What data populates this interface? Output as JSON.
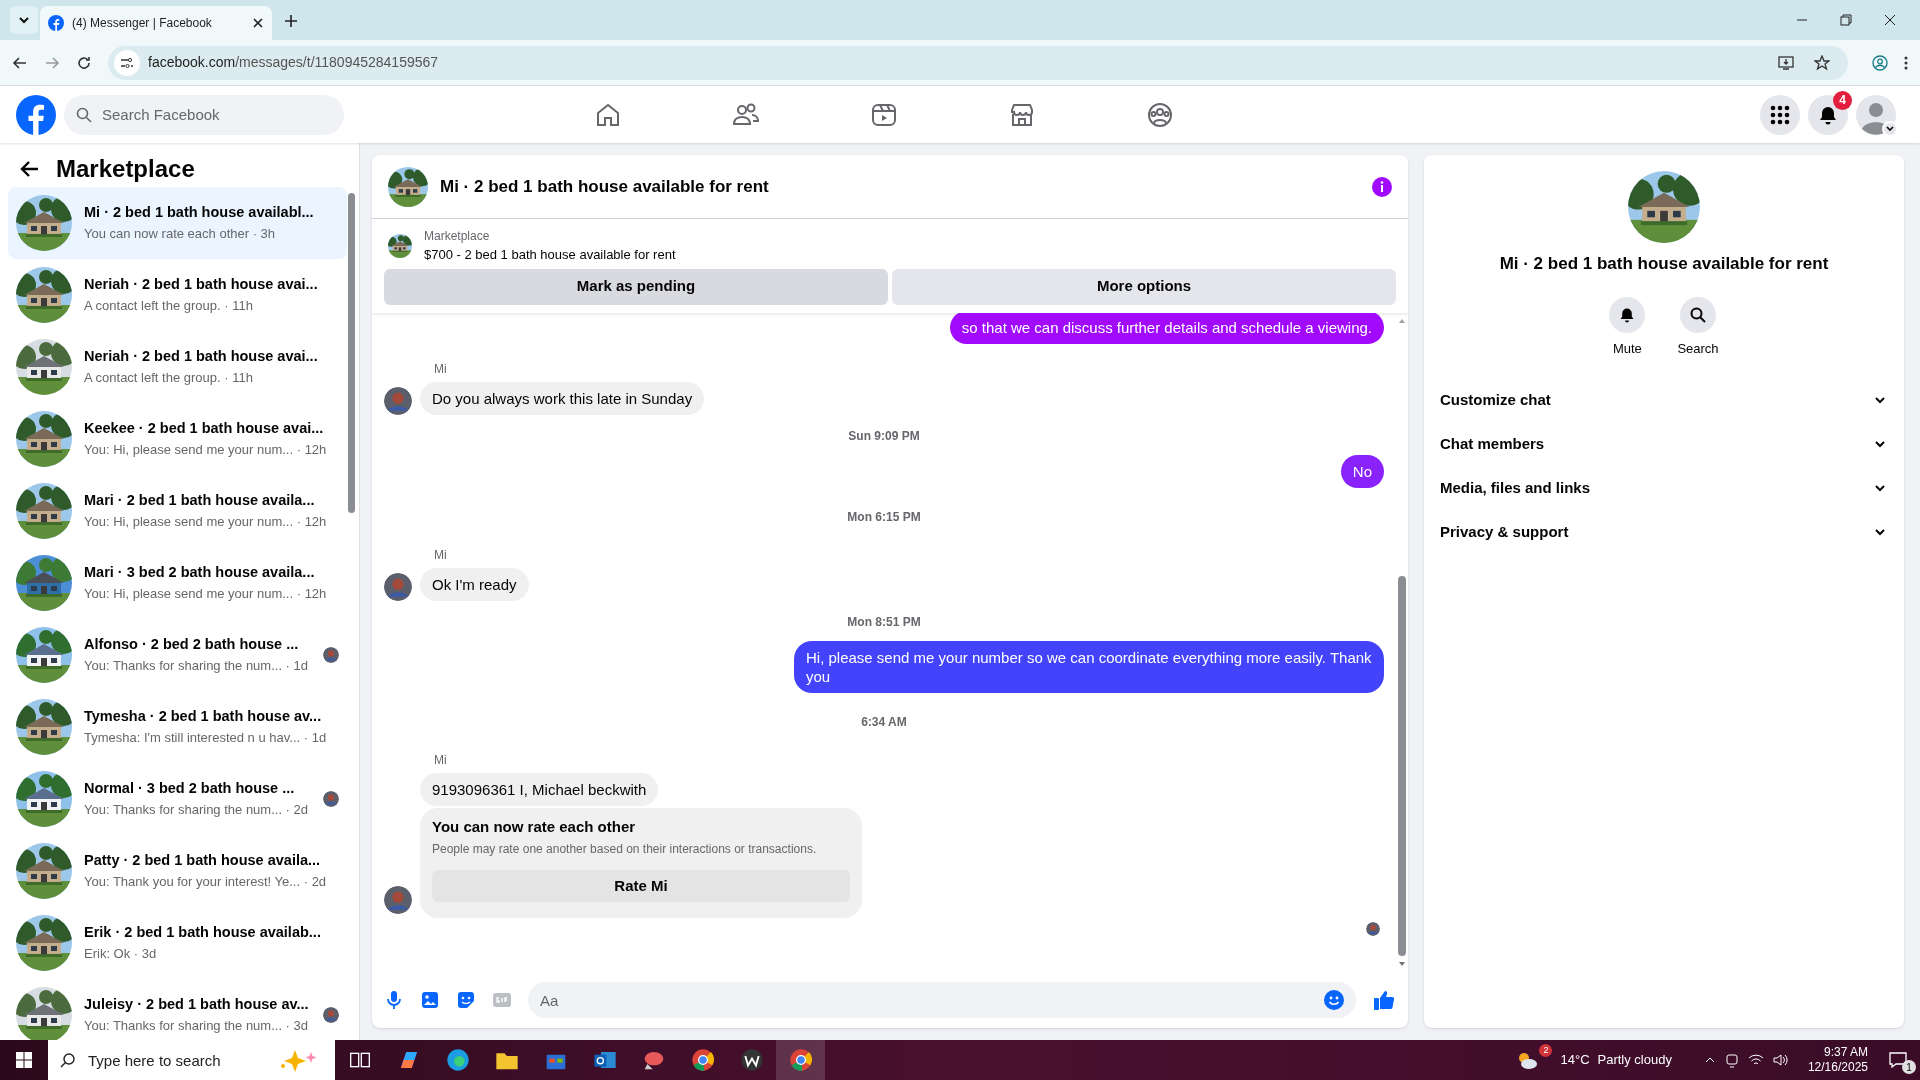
{
  "browser": {
    "tab_title": "(4) Messenger | Facebook",
    "url_host": "facebook.com",
    "url_path": "/messages/t/1180945284159567"
  },
  "top_nav": {
    "search_placeholder": "Search Facebook",
    "notification_count": "4"
  },
  "sidebar": {
    "title": "Marketplace",
    "conversations": [
      {
        "title": "Mi · 2 bed 1 bath house availabl...",
        "snippet": "You can now rate each other · 3h",
        "selected": true,
        "seen": false
      },
      {
        "title": "Neriah · 2 bed 1 bath house avai...",
        "snippet": "A contact left the group. · 11h",
        "selected": false,
        "seen": false
      },
      {
        "title": "Neriah · 2 bed 1 bath house avai...",
        "snippet": "A contact left the group. · 11h",
        "selected": false,
        "seen": false
      },
      {
        "title": "Keekee · 2 bed 1 bath house avai...",
        "snippet": "You: Hi, please send me your num... · 12h",
        "selected": false,
        "seen": false
      },
      {
        "title": "Mari · 2 bed 1 bath house availa...",
        "snippet": "You: Hi, please send me your num... · 12h",
        "selected": false,
        "seen": false
      },
      {
        "title": "Mari · 3 bed 2 bath house availa...",
        "snippet": "You: Hi, please send me your num... · 12h",
        "selected": false,
        "seen": false
      },
      {
        "title": "Alfonso · 2 bed 2 bath house ...",
        "snippet": "You: Thanks for sharing the num... · 1d",
        "selected": false,
        "seen": true
      },
      {
        "title": "Tymesha · 2 bed 1 bath house av...",
        "snippet": "Tymesha: I'm still interested n u hav... · 1d",
        "selected": false,
        "seen": false
      },
      {
        "title": "Normal · 3 bed 2 bath house ...",
        "snippet": "You: Thanks for sharing the num... · 2d",
        "selected": false,
        "seen": true
      },
      {
        "title": "Patty · 2 bed 1 bath house availa...",
        "snippet": "You: Thank you for your interest! Ye... · 2d",
        "selected": false,
        "seen": false
      },
      {
        "title": "Erik · 2 bed 1 bath house availab...",
        "snippet": "Erik: Ok · 3d",
        "selected": false,
        "seen": false
      },
      {
        "title": "Juleisy · 2 bed 1 bath house av...",
        "snippet": "You: Thanks for sharing the num... · 3d",
        "selected": false,
        "seen": true
      }
    ]
  },
  "chat": {
    "title": "Mi · 2 bed 1 bath house available for rent",
    "listing": {
      "label": "Marketplace",
      "price_title": "$700 - 2 bed 1 bath house available for rent",
      "buttons": [
        "Mark as pending",
        "More options"
      ]
    },
    "messages": [
      {
        "kind": "outgoing",
        "text": "so that we can discuss further details and schedule a viewing.",
        "color": "#a10afc"
      },
      {
        "kind": "incoming",
        "sender": "Mi",
        "text": "Do you always work this late in Sunday",
        "avatar": true
      },
      {
        "kind": "time",
        "text": "Sun 9:09 PM"
      },
      {
        "kind": "outgoing",
        "text": "No",
        "color": "#8a22fc"
      },
      {
        "kind": "time",
        "text": "Mon 6:15 PM"
      },
      {
        "kind": "incoming",
        "sender": "Mi",
        "text": "Ok I'm ready",
        "avatar": true
      },
      {
        "kind": "time",
        "text": "Mon 8:51 PM"
      },
      {
        "kind": "outgoing",
        "text": "Hi, please send me your number so we can coordinate everything more easily. Thank you",
        "color": "#4343fb"
      },
      {
        "kind": "time",
        "text": "6:34 AM"
      },
      {
        "kind": "incoming",
        "sender": "Mi",
        "text": "9193096361 I, Michael beckwith",
        "avatar": false
      },
      {
        "kind": "rating",
        "title": "You can now rate each other",
        "body": "People may rate one another based on their interactions or transactions.",
        "button": "Rate Mi",
        "avatar": true
      }
    ],
    "composer_placeholder": "Aa"
  },
  "details": {
    "title": "Mi · 2 bed 1 bath house available for rent",
    "actions": [
      "Mute",
      "Search"
    ],
    "sections": [
      "Customize chat",
      "Chat members",
      "Media, files and links",
      "Privacy & support"
    ]
  },
  "taskbar": {
    "search_placeholder": "Type here to search",
    "weather_badge": "2",
    "temperature": "14°C",
    "weather": "Partly cloudy",
    "time": "9:37 AM",
    "date": "12/16/2025",
    "notification_count": "1"
  }
}
